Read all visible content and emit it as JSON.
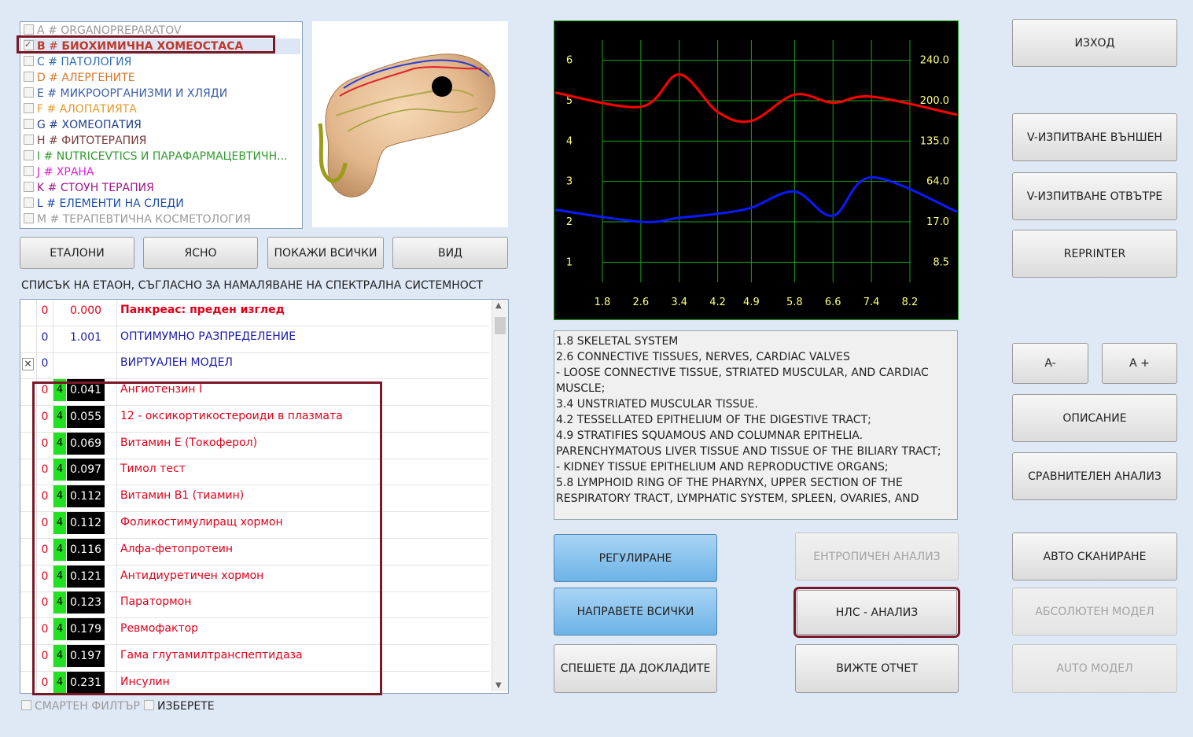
{
  "categories": [
    {
      "letter": "A",
      "label": "ORGANOPREPARATOV",
      "color": "#9a9a9a",
      "checked": false
    },
    {
      "letter": "B",
      "label": "БИОХИМИЧНА ХОМЕОСТАСА",
      "color": "#c0392b",
      "checked": true
    },
    {
      "letter": "C",
      "label": "ПАТОЛОГИЯ",
      "color": "#2e6db4",
      "checked": false
    },
    {
      "letter": "D",
      "label": "АЛЕРГЕНИТЕ",
      "color": "#d9782b",
      "checked": false
    },
    {
      "letter": "E",
      "label": "МИКРООРГАНИЗМИ И ХЛЯДИ",
      "color": "#3b5ea8",
      "checked": false
    },
    {
      "letter": "F",
      "label": "АЛОПАТИЯТА",
      "color": "#e29a2b",
      "checked": false
    },
    {
      "letter": "G",
      "label": "ХОМЕОПАТИЯ",
      "color": "#1d3e8c",
      "checked": false
    },
    {
      "letter": "H",
      "label": "ФИТОТЕРАПИЯ",
      "color": "#7a3a3a",
      "checked": false
    },
    {
      "letter": "I",
      "label": "NUTRICEVTICS И ПАРАФАРМАЦЕВТИЧН...",
      "color": "#2f9a2f",
      "checked": false
    },
    {
      "letter": "J",
      "label": "ХРАНА",
      "color": "#e020d8",
      "checked": false
    },
    {
      "letter": "K",
      "label": "СТОУН ТЕРАПИЯ",
      "color": "#a0148c",
      "checked": false
    },
    {
      "letter": "L",
      "label": "ЕЛЕМЕНТИ НА СЛЕДИ",
      "color": "#1c4fae",
      "checked": false
    },
    {
      "letter": "M",
      "label": "ТЕРАПЕВТИЧНА КОСМЕТОЛОГИЯ",
      "color": "#9a9a9a",
      "checked": false
    }
  ],
  "buttons": {
    "etaloni": "ЕТАЛОНИ",
    "clear": "ЯСНО",
    "show_all": "ПОКАЖИ ВСИЧКИ",
    "view": "ВИД",
    "exit": "ИЗХОД",
    "v_ext": "V-ИЗПИТВАНЕ ВЪНШЕН",
    "v_int": "V-ИЗПИТВАНЕ ОТВЪТРЕ",
    "reprinter": "REPRINTER",
    "a_minus": "A-",
    "a_plus": "A +",
    "description": "ОПИСАНИЕ",
    "comparative": "СРАВНИТЕЛЕН АНАЛИЗ",
    "regulate": "РЕГУЛИРАНЕ",
    "entropic": "ЕНТРОПИЧЕН АНАЛИЗ",
    "auto_scan": "АВТО СКАНИРАНЕ",
    "do_all": "НАПРАВЕТЕ ВСИЧКИ",
    "nls": "НЛС - АНАЛИЗ",
    "absolute": "АБСОЛЮТЕН МОДЕЛ",
    "hurry": "СПЕШЕТЕ ДА ДОКЛАДИТЕ",
    "see_report": "ВИЖТЕ ОТЧЕТ",
    "auto_model": "AUTO МОДЕЛ"
  },
  "list_title": "СПИСЪК НА ЕТАОН, СЪГЛАСНО ЗА НАМАЛЯВАНЕ НА СПЕКТРАЛНА СИСТЕМНОСТ",
  "header_rows": [
    {
      "col0": "0",
      "value": "0.000",
      "name": "Панкреас: преден изглед",
      "name_color": "#e0001a",
      "bold": true,
      "marker": ""
    },
    {
      "col0": "0",
      "value": "1.001",
      "name": "ОПТИМУМНО РАЗПРЕДЕЛЕНИЕ",
      "name_color": "#1a1aa8",
      "bold": false,
      "marker": ""
    },
    {
      "col0": "0",
      "value": "",
      "name": "ВИРТУАЛЕН МОДЕЛ",
      "name_color": "#1a1aa8",
      "bold": false,
      "marker": "×"
    }
  ],
  "results": [
    {
      "col0": "0",
      "grade": "4",
      "value": "0.041",
      "name": "Ангиотензин I"
    },
    {
      "col0": "0",
      "grade": "4",
      "value": "0.055",
      "name": "12 - оксикортикостероиди в плазмата"
    },
    {
      "col0": "0",
      "grade": "4",
      "value": "0.069",
      "name": "Витамин E (Токоферол)"
    },
    {
      "col0": "0",
      "grade": "4",
      "value": "0.097",
      "name": "Тимол тест"
    },
    {
      "col0": "0",
      "grade": "4",
      "value": "0.112",
      "name": "Витамин B1 (тиамин)"
    },
    {
      "col0": "0",
      "grade": "4",
      "value": "0.112",
      "name": "Фоликостимулиращ хормон"
    },
    {
      "col0": "0",
      "grade": "4",
      "value": "0.116",
      "name": "Алфа-фетопротеин"
    },
    {
      "col0": "0",
      "grade": "4",
      "value": "0.121",
      "name": "Антидиуретичен хормон"
    },
    {
      "col0": "0",
      "grade": "4",
      "value": "0.123",
      "name": "Паратормон"
    },
    {
      "col0": "0",
      "grade": "4",
      "value": "0.179",
      "name": "Ревмофактор"
    },
    {
      "col0": "0",
      "grade": "4",
      "value": "0.197",
      "name": "Гама глутамилтранспептидаза"
    },
    {
      "col0": "0",
      "grade": "4",
      "value": "0.231",
      "name": "Инсулин"
    }
  ],
  "footer": {
    "smart_filter": "СМАРТЕН ФИЛТЪР",
    "select": "ИЗБЕРЕТЕ"
  },
  "chart_data": {
    "type": "line",
    "x_ticks": [
      "1.8",
      "2.6",
      "3.4",
      "4.2",
      "4.9",
      "5.8",
      "6.6",
      "7.4",
      "8.2"
    ],
    "left_ticks": [
      "6",
      "5",
      "4",
      "3",
      "2",
      "1"
    ],
    "right_ticks": [
      "240.0",
      "200.0",
      "135.0",
      "64.0",
      "17.0",
      "8.5"
    ],
    "xlim": [
      1.8,
      8.2
    ],
    "ylim": [
      0.5,
      6.5
    ],
    "colors": {
      "background": "#000000",
      "grid": "#1aa31a",
      "border": "#1aa31a",
      "ticks": "#ffff80",
      "red": "#ff0000",
      "blue": "#0a1aff"
    },
    "series": [
      {
        "color": "#ff0000",
        "points": [
          [
            1.8,
            5.2
          ],
          [
            2.6,
            4.85
          ],
          [
            3.4,
            5.65
          ],
          [
            4.2,
            4.72
          ],
          [
            4.9,
            4.5
          ],
          [
            5.8,
            5.15
          ],
          [
            6.6,
            4.95
          ],
          [
            7.4,
            5.1
          ],
          [
            8.2,
            4.65
          ]
        ]
      },
      {
        "color": "#0a1aff",
        "points": [
          [
            1.8,
            2.3
          ],
          [
            2.6,
            2.0
          ],
          [
            3.4,
            2.1
          ],
          [
            4.2,
            2.2
          ],
          [
            4.9,
            2.35
          ],
          [
            5.8,
            2.75
          ],
          [
            6.6,
            2.15
          ],
          [
            7.4,
            3.1
          ],
          [
            8.2,
            2.25
          ]
        ]
      }
    ]
  },
  "description_lines": [
    "1.8 SKELETAL SYSTEM",
    "2.6 CONNECTIVE TISSUES, NERVES, CARDIAC VALVES",
    "- LOOSE CONNECTIVE TISSUE, STRIATED MUSCULAR, AND CARDIAC MUSCLE;",
    "3.4 UNSTRIATED MUSCULAR TISSUE.",
    "4.2 TESSELLATED EPITHELIUM OF THE DIGESTIVE TRACT;",
    "4.9 STRATIFIES SQUAMOUS AND COLUMNAR EPITHELIA. PARENCHYMATOUS LIVER TISSUE AND TISSUE OF THE BILIARY TRACT;",
    "- KIDNEY TISSUE EPITHELIUM AND REPRODUCTIVE ORGANS;",
    "5.8 LYMPHOID RING OF THE PHARYNX, UPPER SECTION OF THE RESPIRATORY TRACT, LYMPHATIC SYSTEM, SPLEEN, OVARIES, AND"
  ]
}
